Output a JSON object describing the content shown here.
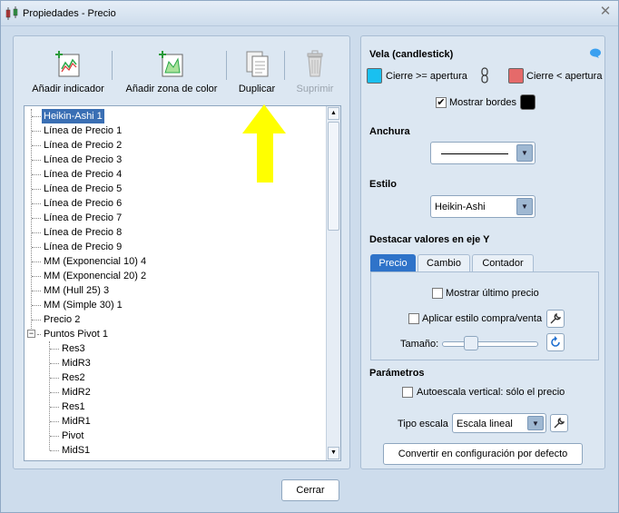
{
  "window": {
    "title": "Propiedades - Precio"
  },
  "toolbar": {
    "add_indicator": "Añadir indicador",
    "add_color_zone": "Añadir zona de color",
    "duplicate": "Duplicar",
    "delete": "Suprimir"
  },
  "tree": {
    "root_items": [
      "Heikin-Ashi 1",
      "Línea de Precio 1",
      "Línea de Precio 2",
      "Línea de Precio 3",
      "Línea de Precio 4",
      "Línea de Precio 5",
      "Línea de Precio 6",
      "Línea de Precio 7",
      "Línea de Precio 8",
      "Línea de Precio 9",
      "MM (Exponencial 10) 4",
      "MM (Exponencial 20) 2",
      "MM (Hull 25) 3",
      "MM (Simple 30) 1",
      "Precio 2",
      "Puntos Pivot 1"
    ],
    "expander_symbol": "−",
    "pivot_children": [
      "Res3",
      "MidR3",
      "Res2",
      "MidR2",
      "Res1",
      "MidR1",
      "Pivot",
      "MidS1"
    ]
  },
  "candle": {
    "title": "Vela (candlestick)",
    "up_label": "Cierre >= apertura",
    "down_label": "Cierre < apertura",
    "up_color": "#19c0f0",
    "down_color": "#e56a6a",
    "show_borders_label": "Mostrar bordes",
    "show_borders_checked": true,
    "border_color": "#000000"
  },
  "width": {
    "title": "Anchura"
  },
  "style": {
    "title": "Estilo",
    "value": "Heikin-Ashi"
  },
  "highlight": {
    "title": "Destacar valores en eje Y",
    "tabs": [
      "Precio",
      "Cambio",
      "Contador"
    ],
    "active_tab": "Precio",
    "show_last_price": "Mostrar último precio",
    "apply_buy_sell": "Aplicar estilo compra/venta",
    "size_label": "Tamaño:"
  },
  "params": {
    "title": "Parámetros",
    "autoscale_label": "Autoescala vertical: sólo el precio",
    "scale_type_label": "Tipo escala",
    "scale_type_value": "Escala lineal",
    "convert_default": "Convertir en configuración por defecto"
  },
  "footer": {
    "close": "Cerrar"
  },
  "colors": {
    "accent": "#2f73c9",
    "annotation_arrow": "#ffff00"
  }
}
